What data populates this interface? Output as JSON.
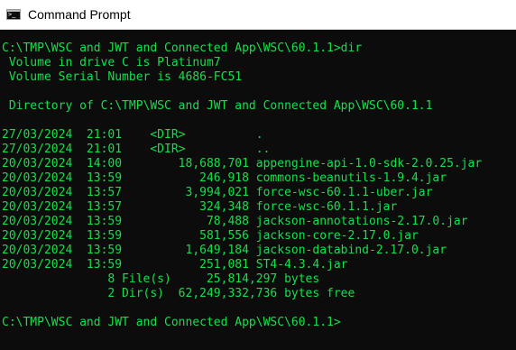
{
  "window": {
    "title": "Command Prompt",
    "icon": "cmd-icon",
    "icon_glyph": ">_"
  },
  "console": {
    "text_color": "#13e04b",
    "background": "#0c0c0c",
    "lines": [
      "C:\\TMP\\WSC and JWT and Connected App\\WSC\\60.1.1>dir",
      " Volume in drive C is Platinum7",
      " Volume Serial Number is 4686-FC51",
      "",
      " Directory of C:\\TMP\\WSC and JWT and Connected App\\WSC\\60.1.1",
      "",
      "27/03/2024  21:01    <DIR>          .",
      "27/03/2024  21:01    <DIR>          ..",
      "20/03/2024  14:00        18,688,701 appengine-api-1.0-sdk-2.0.25.jar",
      "20/03/2024  13:59           246,918 commons-beanutils-1.9.4.jar",
      "20/03/2024  13:57         3,994,021 force-wsc-60.1.1-uber.jar",
      "20/03/2024  13:57           324,348 force-wsc-60.1.1.jar",
      "20/03/2024  13:59            78,488 jackson-annotations-2.17.0.jar",
      "20/03/2024  13:59           581,556 jackson-core-2.17.0.jar",
      "20/03/2024  13:59         1,649,184 jackson-databind-2.17.0.jar",
      "20/03/2024  13:59           251,081 ST4-4.3.4.jar",
      "               8 File(s)     25,814,297 bytes",
      "               2 Dir(s)  62,249,332,736 bytes free",
      "",
      "C:\\TMP\\WSC and JWT and Connected App\\WSC\\60.1.1>"
    ]
  }
}
